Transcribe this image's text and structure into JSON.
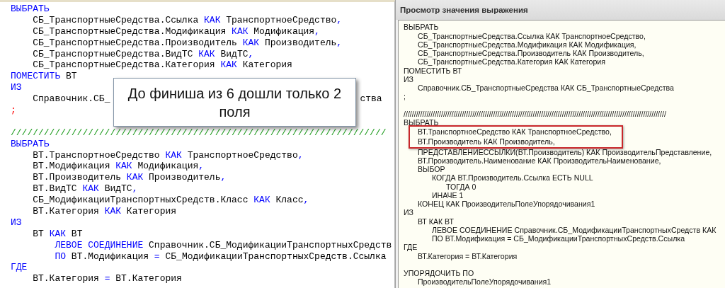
{
  "code_editor": {
    "lines": [
      {
        "kind": "code",
        "tokens": [
          {
            "kind": "kw",
            "text": "ВЫБРАТЬ"
          }
        ]
      },
      {
        "kind": "code",
        "tokens": [
          {
            "kind": "id",
            "text": "\tСБ_ТранспортныеСредства.Ссылка "
          },
          {
            "kind": "kw",
            "text": "КАК"
          },
          {
            "kind": "id",
            "text": " ТранспортноеСредство"
          },
          {
            "kind": "op",
            "text": ","
          }
        ]
      },
      {
        "kind": "code",
        "tokens": [
          {
            "kind": "id",
            "text": "\tСБ_ТранспортныеСредства.Модификация "
          },
          {
            "kind": "kw",
            "text": "КАК"
          },
          {
            "kind": "id",
            "text": " Модификация"
          },
          {
            "kind": "op",
            "text": ","
          }
        ]
      },
      {
        "kind": "code",
        "tokens": [
          {
            "kind": "id",
            "text": "\tСБ_ТранспортныеСредства.Производитель "
          },
          {
            "kind": "kw",
            "text": "КАК"
          },
          {
            "kind": "id",
            "text": " Производитель"
          },
          {
            "kind": "op",
            "text": ","
          }
        ]
      },
      {
        "kind": "code",
        "tokens": [
          {
            "kind": "id",
            "text": "\tСБ_ТранспортныеСредства.ВидТС "
          },
          {
            "kind": "kw",
            "text": "КАК"
          },
          {
            "kind": "id",
            "text": " ВидТС"
          },
          {
            "kind": "op",
            "text": ","
          }
        ]
      },
      {
        "kind": "code",
        "tokens": [
          {
            "kind": "id",
            "text": "\tСБ_ТранспортныеСредства.Категория "
          },
          {
            "kind": "kw",
            "text": "КАК"
          },
          {
            "kind": "id",
            "text": " Категория"
          }
        ]
      },
      {
        "kind": "code",
        "tokens": [
          {
            "kind": "kw",
            "text": "ПОМЕСТИТЬ"
          },
          {
            "kind": "id",
            "text": " ВТ"
          }
        ]
      },
      {
        "kind": "code",
        "tokens": [
          {
            "kind": "kw",
            "text": "ИЗ"
          }
        ]
      },
      {
        "kind": "code",
        "tokens": [
          {
            "kind": "id",
            "text": "\tСправочник.СБ_"
          },
          {
            "kind": "gap"
          },
          {
            "kind": "id",
            "text": "ства"
          }
        ]
      },
      {
        "kind": "code",
        "tokens": [
          {
            "kind": "end",
            "text": ";"
          }
        ]
      },
      {
        "kind": "blank"
      },
      {
        "kind": "code",
        "tokens": [
          {
            "kind": "comment",
            "text": "////////////////////////////////////////////////////////////////////"
          }
        ]
      },
      {
        "kind": "code",
        "tokens": [
          {
            "kind": "kw",
            "text": "ВЫБРАТЬ"
          }
        ]
      },
      {
        "kind": "code",
        "tokens": [
          {
            "kind": "id",
            "text": "\tВТ.ТранспортноеСредство "
          },
          {
            "kind": "kw",
            "text": "КАК"
          },
          {
            "kind": "id",
            "text": " ТранспортноеСредство"
          },
          {
            "kind": "op",
            "text": ","
          }
        ]
      },
      {
        "kind": "code",
        "tokens": [
          {
            "kind": "id",
            "text": "\tВТ.Модификация "
          },
          {
            "kind": "kw",
            "text": "КАК"
          },
          {
            "kind": "id",
            "text": " Модификация"
          },
          {
            "kind": "op",
            "text": ","
          }
        ]
      },
      {
        "kind": "code",
        "tokens": [
          {
            "kind": "id",
            "text": "\tВТ.Производитель "
          },
          {
            "kind": "kw",
            "text": "КАК"
          },
          {
            "kind": "id",
            "text": " Производитель"
          },
          {
            "kind": "op",
            "text": ","
          }
        ]
      },
      {
        "kind": "code",
        "tokens": [
          {
            "kind": "id",
            "text": "\tВТ.ВидТС "
          },
          {
            "kind": "kw",
            "text": "КАК"
          },
          {
            "kind": "id",
            "text": " ВидТС"
          },
          {
            "kind": "op",
            "text": ","
          }
        ]
      },
      {
        "kind": "code",
        "tokens": [
          {
            "kind": "id",
            "text": "\tСБ_МодификацииТранспортныхСредств.Класс "
          },
          {
            "kind": "kw",
            "text": "КАК"
          },
          {
            "kind": "id",
            "text": " Класс"
          },
          {
            "kind": "op",
            "text": ","
          }
        ]
      },
      {
        "kind": "code",
        "tokens": [
          {
            "kind": "id",
            "text": "\tВТ.Категория "
          },
          {
            "kind": "kw",
            "text": "КАК"
          },
          {
            "kind": "id",
            "text": " Категория"
          }
        ]
      },
      {
        "kind": "code",
        "tokens": [
          {
            "kind": "kw",
            "text": "ИЗ"
          }
        ]
      },
      {
        "kind": "code",
        "tokens": [
          {
            "kind": "id",
            "text": "\tВТ "
          },
          {
            "kind": "kw",
            "text": "КАК"
          },
          {
            "kind": "id",
            "text": " ВТ"
          }
        ]
      },
      {
        "kind": "code",
        "tokens": [
          {
            "kind": "kw",
            "text": "\t\tЛЕВОЕ СОЕДИНЕНИЕ"
          },
          {
            "kind": "id",
            "text": " Справочник.СБ_МодификацииТранспортныхСредств"
          }
        ]
      },
      {
        "kind": "code",
        "tokens": [
          {
            "kind": "kw",
            "text": "\t\tПО"
          },
          {
            "kind": "id",
            "text": " ВТ.Модификация "
          },
          {
            "kind": "op",
            "text": "="
          },
          {
            "kind": "id",
            "text": " СБ_МодификацииТранспортныхСредств.Ссылка"
          }
        ]
      },
      {
        "kind": "code",
        "tokens": [
          {
            "kind": "kw",
            "text": "ГДЕ"
          }
        ]
      },
      {
        "kind": "code",
        "tokens": [
          {
            "kind": "id",
            "text": "\tВТ.Категория "
          },
          {
            "kind": "op",
            "text": "="
          },
          {
            "kind": "id",
            "text": " ВТ.Категория"
          }
        ]
      }
    ]
  },
  "callout": {
    "text": "До финиша из 6 дошли только 2 поля"
  },
  "expression_dialog": {
    "title": "Просмотр значения выражения",
    "lines": [
      {
        "kind": "text",
        "text": "ВЫБРАТЬ",
        "highlighted": false
      },
      {
        "kind": "text",
        "text": "\tСБ_ТранспортныеСредства.Ссылка КАК ТранспортноеСредство,",
        "highlighted": false
      },
      {
        "kind": "text",
        "text": "\tСБ_ТранспортныеСредства.Модификация КАК Модификация,",
        "highlighted": false
      },
      {
        "kind": "text",
        "text": "\tСБ_ТранспортныеСредства.Производитель КАК Производитель,",
        "highlighted": false
      },
      {
        "kind": "text",
        "text": "\tСБ_ТранспортныеСредства.Категория КАК Категория",
        "highlighted": false
      },
      {
        "kind": "text",
        "text": "ПОМЕСТИТЬ ВТ",
        "highlighted": false
      },
      {
        "kind": "text",
        "text": "ИЗ",
        "highlighted": false
      },
      {
        "kind": "text",
        "text": "\tСправочник.СБ_ТранспортныеСредства КАК СБ_ТранспортныеСредства",
        "highlighted": false
      },
      {
        "kind": "text",
        "text": ";",
        "highlighted": false
      },
      {
        "kind": "blank",
        "highlighted": false
      },
      {
        "kind": "text",
        "text": "//////////////////////////////////////////////////////////////////////////////////////////////////////////////////////////////",
        "highlighted": false
      },
      {
        "kind": "text",
        "text": "ВЫБРАТЬ",
        "highlighted": false
      },
      {
        "kind": "text",
        "text": "\tВТ.ТранспортноеСредство КАК ТранспортноеСредство,",
        "highlighted": true
      },
      {
        "kind": "text",
        "text": "\tВТ.Производитель КАК Производитель,",
        "highlighted": true
      },
      {
        "kind": "text",
        "text": "\tПРЕДСТАВЛЕНИЕССЫЛКИ(ВТ.Производитель) КАК ПроизводительПредставление,",
        "highlighted": false
      },
      {
        "kind": "text",
        "text": "\tВТ.Производитель.Наименование КАК ПроизводительНаименование,",
        "highlighted": false
      },
      {
        "kind": "text",
        "text": "\tВЫБОР",
        "highlighted": false
      },
      {
        "kind": "text",
        "text": "\t\tКОГДА ВТ.Производитель.Ссылка ЕСТЬ NULL",
        "highlighted": false
      },
      {
        "kind": "text",
        "text": "\t\t\tТОГДА 0",
        "highlighted": false
      },
      {
        "kind": "text",
        "text": "\t\tИНАЧЕ 1",
        "highlighted": false
      },
      {
        "kind": "text",
        "text": "\tКОНЕЦ КАК ПроизводительПолеУпорядочивания1",
        "highlighted": false
      },
      {
        "kind": "text",
        "text": "ИЗ",
        "highlighted": false
      },
      {
        "kind": "text",
        "text": "\tВТ КАК ВТ",
        "highlighted": false
      },
      {
        "kind": "text",
        "text": "\t\tЛЕВОЕ СОЕДИНЕНИЕ Справочник.СБ_МодификацииТранспортныхСредств КАК",
        "highlighted": false
      },
      {
        "kind": "text",
        "text": "\t\tПО ВТ.Модификация = СБ_МодификацииТранспортныхСредств.Ссылка",
        "highlighted": false
      },
      {
        "kind": "text",
        "text": "ГДЕ",
        "highlighted": false
      },
      {
        "kind": "text",
        "text": "\tВТ.Категория = ВТ.Категория",
        "highlighted": false
      },
      {
        "kind": "blank",
        "highlighted": false
      },
      {
        "kind": "text",
        "text": "УПОРЯДОЧИТЬ ПО",
        "highlighted": false
      },
      {
        "kind": "text",
        "text": "\tПроизводительПолеУпорядочивания1",
        "highlighted": false
      }
    ]
  }
}
